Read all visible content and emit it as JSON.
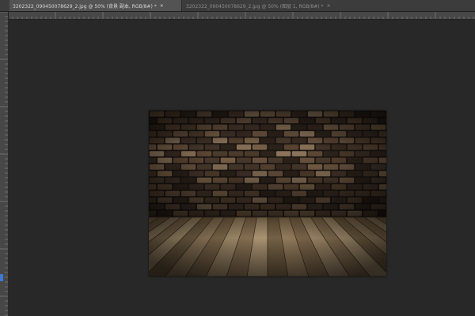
{
  "tabs": [
    {
      "title": "3202322_090450078629_2.jpg @ 50% (背景 副本, RGB/8#) *",
      "close": "×",
      "active": true
    },
    {
      "title": "3202322_090450078629_2.jpg @ 50% (图层 1, RGB/8#) *",
      "close": "×",
      "active": false
    }
  ],
  "colors": {
    "workspace": "#282828",
    "panel": "#3c3c3c",
    "brick_dark": "#3a2e24",
    "floor_light": "#b8a07c"
  },
  "canvas_image": {
    "description": "brick wall above wooden floor"
  }
}
